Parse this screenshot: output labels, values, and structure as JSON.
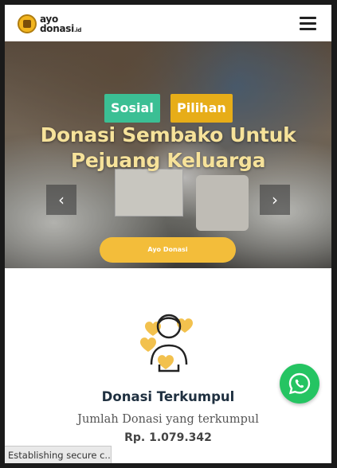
{
  "header": {
    "logo_line1": "ayo",
    "logo_line2": "donasi",
    "logo_suffix": ".id",
    "menu_icon": "hamburger-icon"
  },
  "hero": {
    "tags": [
      "Sosial",
      "Pilihan"
    ],
    "title_line1": "Donasi Sembako Untuk",
    "title_line2": "Pejuang Keluarga",
    "cta_label": "Ayo Donasi",
    "prev_icon": "chevron-left-icon",
    "next_icon": "chevron-right-icon",
    "colors": {
      "sosial": "#3bbf94",
      "pilihan": "#e7ad18",
      "cta": "#f3bd3a",
      "title": "#f6e29a"
    }
  },
  "donation": {
    "icon": "donor-hearts-icon",
    "title": "Donasi Terkumpul",
    "subtitle": "Jumlah Donasi yang terkumpul",
    "amount": "Rp. 1.079.342"
  },
  "whatsapp": {
    "icon": "whatsapp-icon",
    "color": "#25c462"
  },
  "status": {
    "text": "Establishing secure c..."
  }
}
